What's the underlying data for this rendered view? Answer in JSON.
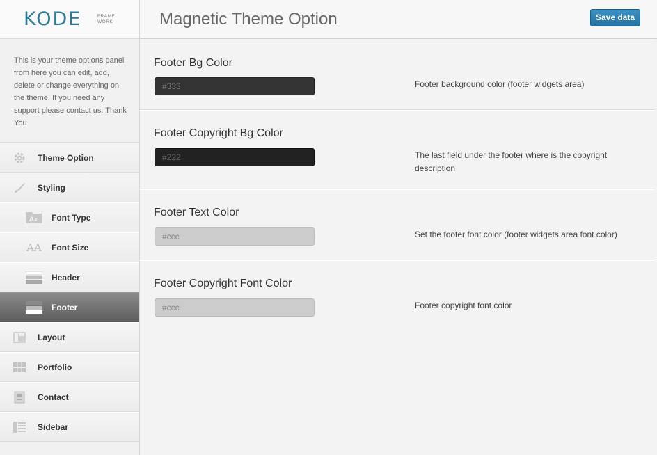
{
  "logo": {
    "name": "KODE",
    "sub_line1": "FRAME",
    "sub_line2": "WORK"
  },
  "sidebar": {
    "intro_text": "This is your theme options panel from here you can edit, add, delete or change everything on the theme. If you need any support please contact us. Thank You",
    "items": [
      {
        "label": "Theme Option",
        "icon": "gear-icon"
      },
      {
        "label": "Styling",
        "icon": "brush-icon"
      },
      {
        "label": "Font Type",
        "icon": "font-type-icon",
        "icon_text": "Az"
      },
      {
        "label": "Font Size",
        "icon": "font-size-icon",
        "icon_text": "AA"
      },
      {
        "label": "Header",
        "icon": "header-layout-icon"
      },
      {
        "label": "Footer",
        "icon": "footer-layout-icon"
      },
      {
        "label": "Layout",
        "icon": "layout-icon"
      },
      {
        "label": "Portfolio",
        "icon": "grid-icon"
      },
      {
        "label": "Contact",
        "icon": "contact-icon"
      },
      {
        "label": "Sidebar",
        "icon": "list-icon"
      }
    ]
  },
  "header": {
    "title": "Magnetic Theme Option",
    "save_label": "Save data"
  },
  "fields": [
    {
      "label": "Footer Bg Color",
      "value": "#333",
      "description": "Footer background color (footer widgets area)"
    },
    {
      "label": "Footer Copyright Bg Color",
      "value": "#222",
      "description": "The last field under the footer where is the copyright description"
    },
    {
      "label": "Footer Text Color",
      "value": "#ccc",
      "description": "Set the footer font color (footer widgets area font color)"
    },
    {
      "label": "Footer Copyright Font Color",
      "value": "#ccc",
      "description": "Footer copyright font color"
    }
  ],
  "colors": {
    "accent": "#2c7a98",
    "button": "#2471a3",
    "active_nav": "#6e6e6e"
  }
}
